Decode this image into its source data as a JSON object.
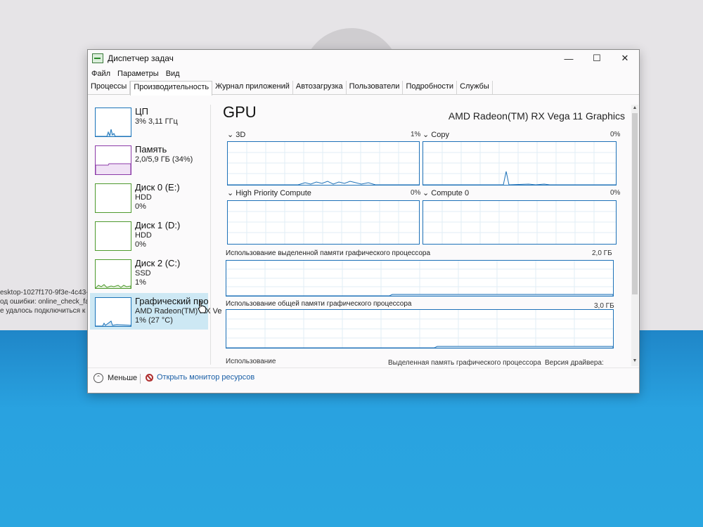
{
  "background": {
    "console_lines": [
      "esktop-1027f170-9f3e-4c43-",
      "од ошибки: online_check_fai",
      "е удалось подключиться к к"
    ]
  },
  "window": {
    "title": "Диспетчер задач",
    "controls": {
      "minimize": "—",
      "maximize": "☐",
      "close": "✕"
    }
  },
  "menu": [
    "Файл",
    "Параметры",
    "Вид"
  ],
  "tabs": [
    "Процессы",
    "Производительность",
    "Журнал приложений",
    "Автозагрузка",
    "Пользователи",
    "Подробности",
    "Службы"
  ],
  "active_tab_index": 1,
  "sidebar": {
    "items": [
      {
        "title": "ЦП",
        "line1": "3% 3,11 ГГц",
        "line2": "",
        "color": "#1a73b9"
      },
      {
        "title": "Память",
        "line1": "2,0/5,9 ГБ (34%)",
        "line2": "",
        "color": "#8b3aa8"
      },
      {
        "title": "Диск 0 (E:)",
        "line1": "HDD",
        "line2": "0%",
        "color": "#4e9a2e"
      },
      {
        "title": "Диск 1 (D:)",
        "line1": "HDD",
        "line2": "0%",
        "color": "#4e9a2e"
      },
      {
        "title": "Диск 2 (C:)",
        "line1": "SSD",
        "line2": "1%",
        "color": "#4e9a2e"
      },
      {
        "title": "Графический про",
        "line1": "AMD Radeon(TM) RX Ve",
        "line2": "1% (27 °C)",
        "color": "#1a73b9"
      }
    ],
    "active_index": 5
  },
  "main": {
    "title": "GPU",
    "device": "AMD Radeon(TM) RX Vega 11 Graphics",
    "engines": [
      {
        "name": "3D",
        "value": "1%"
      },
      {
        "name": "Copy",
        "value": "0%"
      },
      {
        "name": "High Priority Compute",
        "value": "0%"
      },
      {
        "name": "Compute 0",
        "value": "0%"
      }
    ],
    "dedicated": {
      "label": "Использование выделенной памяти графического процессора",
      "max": "2,0 ГБ"
    },
    "shared": {
      "label": "Использование общей памяти графического процессора",
      "max": "3,0 ГБ"
    },
    "bottom": {
      "usage": "Использование",
      "dedicated_mem": "Выделенная память графического процессора",
      "driver": "Версия драйвера:"
    }
  },
  "footer": {
    "fewer": "Меньше",
    "resource_monitor": "Открыть монитор ресурсов"
  },
  "colors": {
    "accent": "#1d71b8",
    "selection": "#cde8f4"
  }
}
